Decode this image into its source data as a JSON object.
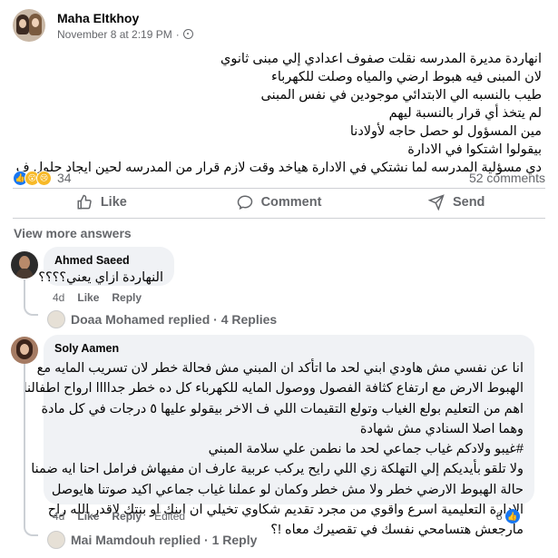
{
  "post": {
    "author": "Maha Eltkhoy",
    "timestamp": "November 8 at 2:19 PM",
    "separator": "·",
    "privacy_icon": "globe-icon",
    "body_lines": [
      "انهاردة مديرة المدرسه نقلت صفوف اعدادي إلي مبنى ثانوي",
      "لان المبنى فيه هبوط ارضي والمياه وصلت للكهرباء",
      "طيب بالنسبه الي الابتدائي موجودين في نفس المبنى",
      "لم يتخذ أي قرار بالنسبة ليهم",
      "مين المسؤول لو حصل حاجه لأولادنا",
      "بيقولوا اشتكوا في الادارة",
      "دي مسؤلية المدرسه لما نشتكي في الادارة هياخد وقت لازم قرار من المدرسه لحين ايجاد حلول ف"
    ],
    "reaction_icons": [
      "like-icon",
      "wow-icon",
      "sad-icon"
    ],
    "reaction_count": "34",
    "comments_count": "52 comments"
  },
  "actions": {
    "like": "Like",
    "comment": "Comment",
    "send": "Send"
  },
  "view_more": "View more answers",
  "comments": [
    {
      "name": "Ahmed Saeed",
      "text_lines": [
        "النهاردة ازاي يعني؟؟؟؟"
      ],
      "time": "4d",
      "like": "Like",
      "reply": "Reply",
      "replied_by": "Doaa Mohamed replied · 4 Replies"
    },
    {
      "name": "Soly Aamen",
      "text_lines": [
        "انا عن نفسي مش هاودي ابني لحد ما اتأكد ان المبني مش فحالة خطر لان تسريب المايه مع",
        "الهبوط الارض مع ارتفاع كثافة الفصول ووصول المايه للكهرباء كل ده خطر جداااا ارواح اطفالنا",
        "اهم من التعليم بولع الغياب وتولع التقيمات اللي ف الاخر بيقولو عليها ٥ درجات في كل مادة",
        "وهما اصلا السنادي مش شهادة",
        "#غيبو ولادكم غياب جماعي لحد ما نطمن علي سلامة المبني",
        "ولا تلقو بأيديكم إلي التهلكة زي اللي رايح يركب عربية عارف ان مفيهاش فرامل احنا ايه ضمنا",
        "حالة الهبوط الارضي خطر ولا مش خطر وكمان لو عملنا غياب جماعي اكيد صوتنا هايوصل",
        "الادارة التعليمية اسرع واقوي من مجرد تقديم شكاوي تخيلي ان ابنك او بنتك لاقدر الله راح",
        "مارجعش هتسامحي نفسك في تقصيرك معاه !؟"
      ],
      "time": "4d",
      "like": "Like",
      "reply": "Reply",
      "edited": "Edited",
      "reactions": "8",
      "replied_by": "Mai Mamdouh replied · 1 Reply"
    }
  ]
}
